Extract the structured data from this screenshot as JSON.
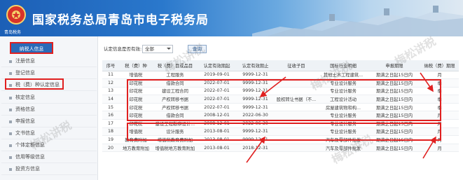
{
  "header": {
    "title": "国家税务总局青岛市电子税务局",
    "emblem_caption": "青岛税务"
  },
  "sidebar": {
    "active": "纳税人信息",
    "items": [
      "注册信息",
      "登记信息",
      "税（费）种认定信息",
      "核定信息",
      "资格信息",
      "申报信息",
      "文书信息",
      "个体定额信息",
      "信用等级信息",
      "投资方信息"
    ]
  },
  "filter": {
    "label": "认定信息是否有效:",
    "select_value": "全部",
    "query_label": "查询"
  },
  "table": {
    "columns": [
      "序号",
      "税（费）种",
      "税（费）目或品目",
      "认定有效期起",
      "认定有效期止",
      "征收子目",
      "国标行业明细",
      "申报期限",
      "纳税（费）期限"
    ],
    "rows": [
      [
        "11",
        "增值税",
        "工程服务",
        "2019-09-01",
        "9999-12-31",
        "",
        "其他土木工程建筑...",
        "期满之日起15日内",
        "月"
      ],
      [
        "12",
        "印花税",
        "借款合同",
        "2022-07-01",
        "9999-12-31",
        "",
        "专业设计服务",
        "期满之日起15日内",
        "季"
      ],
      [
        "13",
        "印花税",
        "建设工程合同",
        "2022-07-01",
        "9999-12-31",
        "",
        "专业设计服务",
        "期满之日起15日内",
        "季"
      ],
      [
        "14",
        "印花税",
        "产权转移书据",
        "2022-07-01",
        "9999-12-31",
        "股权转让书据（不...",
        "工程设计活动",
        "期满之日起15日内",
        "季"
      ],
      [
        "15",
        "印花税",
        "产权转移书据",
        "2022-07-01",
        "9999-12-31",
        "",
        "房屋建筑物和构...",
        "期满之日起15日内",
        "季"
      ],
      [
        "16",
        "印花税",
        "借款合同",
        "2008-12-01",
        "2022-06-30",
        "",
        "专业设计服务",
        "期满之日起15日内",
        "月"
      ],
      [
        "17",
        "印花税",
        "建设工程勘察设计...",
        "2008-12-01",
        "2022-06-30",
        "",
        "专业设计服务",
        "期满之日起15日内",
        "月"
      ],
      [
        "18",
        "增值税",
        "设计服务",
        "2013-08-01",
        "9999-12-31",
        "",
        "专业设计服务",
        "期满之日起15日内",
        "月"
      ],
      [
        "19",
        "教育费附加",
        "增值税教育费附加",
        "2013-08-01",
        "9999-12-31",
        "",
        "汽车及零部件批发",
        "期满之日起15日内",
        "月"
      ],
      [
        "20",
        "地方教育附加",
        "增值税地方教育附加",
        "2013-08-01",
        "2018-12-31",
        "",
        "汽车及零部件批发",
        "期满之日起15日内",
        "月"
      ]
    ]
  },
  "watermark": "梅松讲税",
  "colors": {
    "highlight": "#e02020",
    "header_blue": "#1c5fb6"
  }
}
